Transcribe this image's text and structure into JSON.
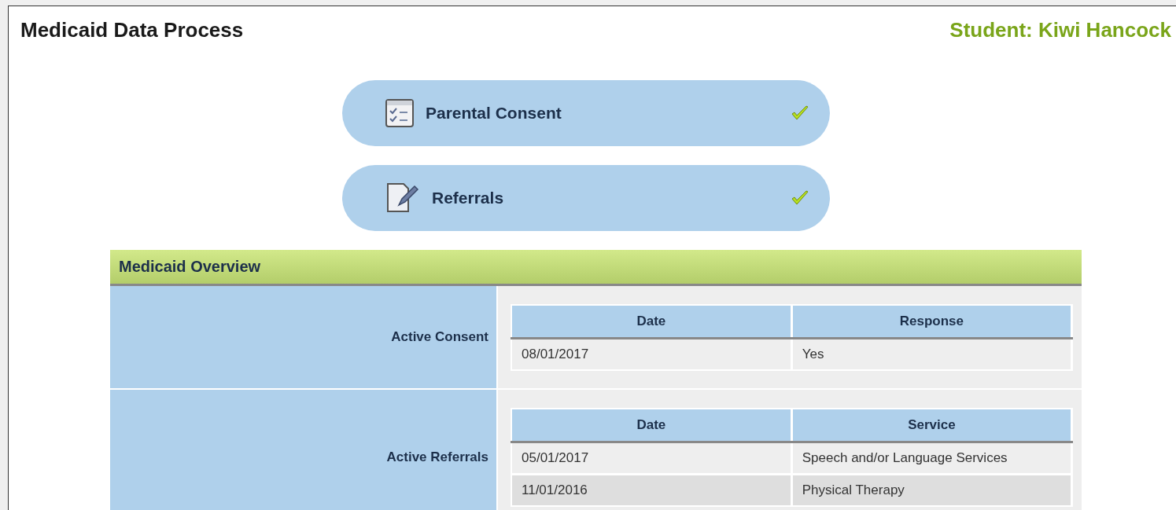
{
  "title": "Medicaid Data Process",
  "student": "Student: Kiwi Hancock",
  "steps": [
    {
      "label": "Parental Consent",
      "kind": "checklist",
      "done": true
    },
    {
      "label": "Referrals",
      "kind": "note",
      "done": true
    }
  ],
  "overview": {
    "title": "Medicaid Overview",
    "sections": [
      {
        "label": "Active Consent",
        "columns": [
          "Date",
          "Response"
        ],
        "rows": [
          [
            "08/01/2017",
            "Yes"
          ]
        ]
      },
      {
        "label": "Active Referrals",
        "columns": [
          "Date",
          "Service"
        ],
        "rows": [
          [
            "05/01/2017",
            "Speech and/or Language Services"
          ],
          [
            "11/01/2016",
            "Physical Therapy"
          ]
        ]
      }
    ]
  }
}
